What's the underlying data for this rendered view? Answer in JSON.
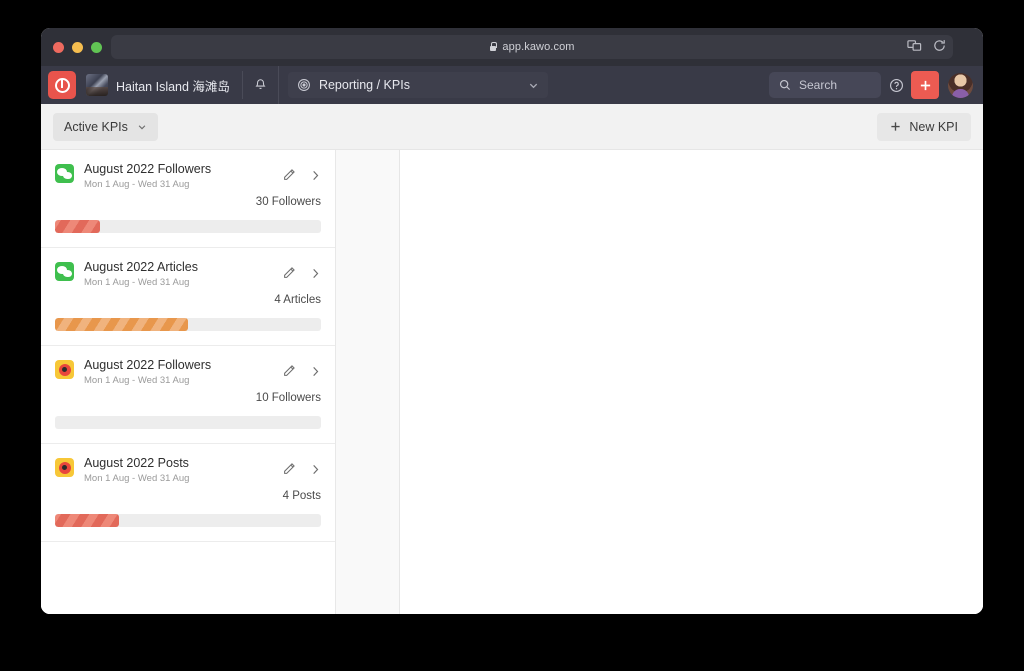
{
  "browser": {
    "url": "app.kawo.com",
    "lock_icon": "lock-icon",
    "tab_preview_icon": "tab-preview-icon",
    "reload_icon": "reload-icon",
    "traffic_lights": [
      "close-red",
      "minimize-yellow",
      "maximize-green"
    ]
  },
  "app_header": {
    "logo_icon": "kawo-logo-icon",
    "brand_name": "Haitan Island 海滩岛",
    "brand_thumb": "brand-thumbnail",
    "notifications_icon": "bell-icon",
    "nav": {
      "icon": "target-icon",
      "label": "Reporting / KPIs",
      "chevron": "chevron-down-icon"
    },
    "search": {
      "icon": "search-icon",
      "placeholder": "Search"
    },
    "help_icon": "help-circle-icon",
    "add_icon": "plus-icon",
    "add_button_color": "#ec5b52",
    "avatar": "user-avatar"
  },
  "toolbar": {
    "filter_label": "Active KPIs",
    "filter_chevron": "chevron-down-icon",
    "new_kpi_label": "New KPI",
    "new_kpi_icon": "plus-icon"
  },
  "kpis": [
    {
      "platform": "wechat",
      "platform_icon": "wechat-icon",
      "title": "August 2022 Followers",
      "date_range": "Mon 1 Aug - Wed 31 Aug",
      "value": "30 Followers",
      "progress_percent": 17,
      "progress_color": "red",
      "edit_icon": "pencil-icon",
      "open_icon": "chevron-right-icon"
    },
    {
      "platform": "wechat",
      "platform_icon": "wechat-icon",
      "title": "August 2022 Articles",
      "date_range": "Mon 1 Aug - Wed 31 Aug",
      "value": "4 Articles",
      "progress_percent": 50,
      "progress_color": "orange",
      "edit_icon": "pencil-icon",
      "open_icon": "chevron-right-icon"
    },
    {
      "platform": "weibo",
      "platform_icon": "weibo-icon",
      "title": "August 2022 Followers",
      "date_range": "Mon 1 Aug - Wed 31 Aug",
      "value": "10 Followers",
      "progress_percent": 0,
      "progress_color": "red",
      "edit_icon": "pencil-icon",
      "open_icon": "chevron-right-icon"
    },
    {
      "platform": "weibo",
      "platform_icon": "weibo-icon",
      "title": "August 2022 Posts",
      "date_range": "Mon 1 Aug - Wed 31 Aug",
      "value": "4 Posts",
      "progress_percent": 24,
      "progress_color": "red",
      "edit_icon": "pencil-icon",
      "open_icon": "chevron-right-icon"
    }
  ],
  "colors": {
    "accent": "#ec5b52",
    "header_bg": "#393a47",
    "titlebar_bg": "#2f3038",
    "toolbar_bg": "#f2f2f2",
    "wechat_green": "#3fbf4e",
    "weibo_yellow": "#f7c737",
    "bar_red": "#e2695a",
    "bar_orange": "#e8974c",
    "bar_track": "#ededed"
  }
}
